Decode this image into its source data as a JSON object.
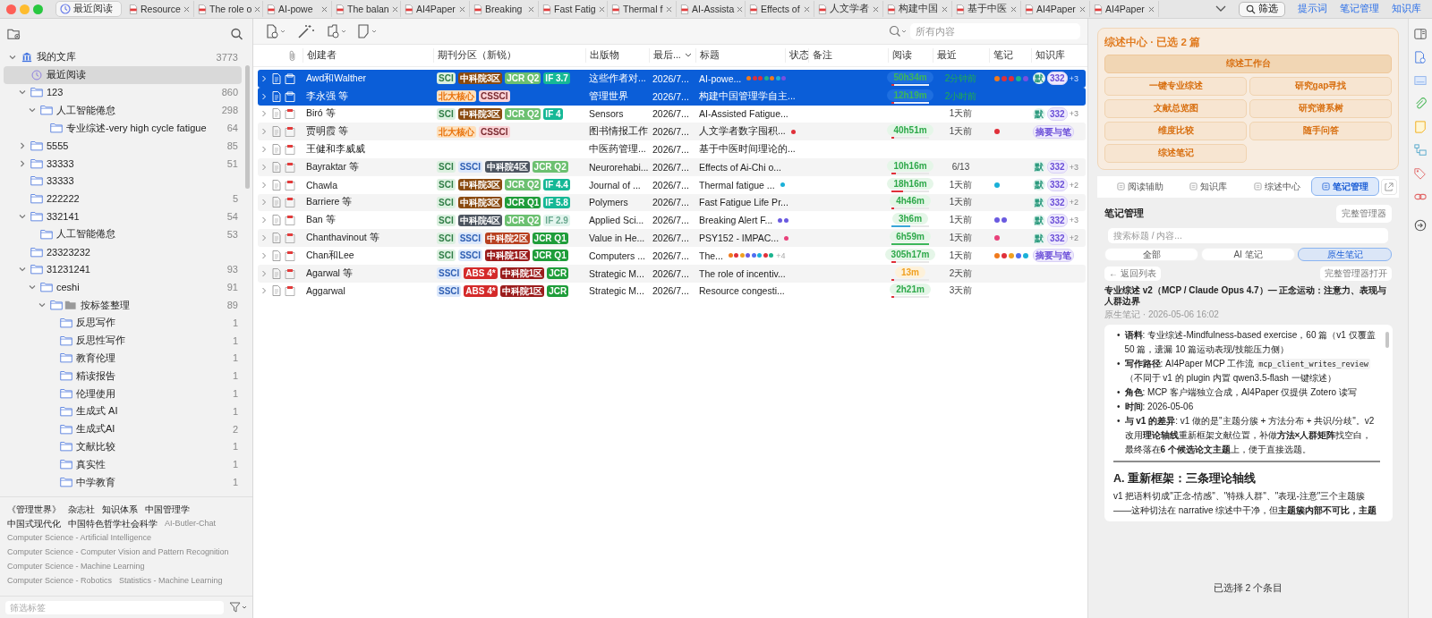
{
  "tabbar": {
    "tabs": [
      {
        "label": "最近阅读",
        "kind": "home",
        "selected": true
      },
      {
        "label": "Resource",
        "kind": "pdf",
        "selected": false
      },
      {
        "label": "The role o",
        "kind": "pdf",
        "selected": false
      },
      {
        "label": "AI-powe",
        "kind": "pdf",
        "selected": false
      },
      {
        "label": "The balan",
        "kind": "pdf",
        "selected": false
      },
      {
        "label": "AI4Paper",
        "kind": "pdf",
        "selected": false
      },
      {
        "label": "Breaking",
        "kind": "pdf",
        "selected": false
      },
      {
        "label": "Fast Fatig",
        "kind": "pdf",
        "selected": false
      },
      {
        "label": "Thermal f",
        "kind": "pdf",
        "selected": false
      },
      {
        "label": "AI-Assista",
        "kind": "pdf",
        "selected": false
      },
      {
        "label": "Effects of",
        "kind": "pdf",
        "selected": false
      },
      {
        "label": "人文学者",
        "kind": "pdf",
        "selected": false
      },
      {
        "label": "构建中国",
        "kind": "pdf",
        "selected": false
      },
      {
        "label": "基于中医",
        "kind": "pdf",
        "selected": false
      },
      {
        "label": "AI4Paper",
        "kind": "pdf",
        "selected": false
      },
      {
        "label": "AI4Paper",
        "kind": "pdf",
        "selected": false
      }
    ],
    "filter_button": "筛选",
    "links": [
      "提示词",
      "笔记管理",
      "知识库"
    ]
  },
  "sidebar": {
    "tree": [
      {
        "label": "我的文库",
        "count": "3773",
        "kind": "library",
        "expanded": true,
        "selected": false,
        "children": [
          {
            "label": "最近阅读",
            "kind": "clock",
            "selected": true
          },
          {
            "label": "123",
            "count": "860",
            "kind": "folder",
            "expanded": true,
            "selected": false,
            "children": [
              {
                "label": "人工智能倦怠",
                "count": "298",
                "kind": "folder",
                "expanded": true,
                "selected": false,
                "children": [
                  {
                    "label": "专业综述-very high cycle fatigue",
                    "count": "64",
                    "kind": "folder",
                    "selected": false
                  }
                ]
              }
            ]
          },
          {
            "label": "5555",
            "count": "85",
            "kind": "folder",
            "expanded": false,
            "selected": false
          },
          {
            "label": "33333",
            "count": "51",
            "kind": "folder",
            "expanded": false,
            "selected": false
          },
          {
            "label": "33333",
            "kind": "folder",
            "selected": false
          },
          {
            "label": "222222",
            "count": "5",
            "kind": "folder",
            "selected": false
          },
          {
            "label": "332141",
            "count": "54",
            "kind": "folder",
            "expanded": true,
            "selected": false,
            "children": [
              {
                "label": "人工智能倦怠",
                "count": "53",
                "kind": "folder",
                "selected": false
              }
            ]
          },
          {
            "label": "23323232",
            "kind": "folder",
            "selected": false
          },
          {
            "label": "31231241",
            "count": "93",
            "kind": "folder",
            "expanded": true,
            "selected": false,
            "children": [
              {
                "label": "ceshi",
                "count": "91",
                "kind": "folder",
                "expanded": true,
                "selected": false,
                "children": [
                  {
                    "label": "按标签整理",
                    "count": "89",
                    "kind": "tagfolder",
                    "expanded": true,
                    "selected": false,
                    "children": [
                      {
                        "label": "反思写作",
                        "count": "1",
                        "kind": "folder",
                        "selected": false
                      },
                      {
                        "label": "反思性写作",
                        "count": "1",
                        "kind": "folder",
                        "selected": false
                      },
                      {
                        "label": "教育伦理",
                        "count": "1",
                        "kind": "folder",
                        "selected": false
                      },
                      {
                        "label": "精读报告",
                        "count": "1",
                        "kind": "folder",
                        "selected": false
                      },
                      {
                        "label": "伦理使用",
                        "count": "1",
                        "kind": "folder",
                        "selected": false
                      },
                      {
                        "label": "生成式 AI",
                        "count": "1",
                        "kind": "folder",
                        "selected": false
                      },
                      {
                        "label": "生成式AI",
                        "count": "2",
                        "kind": "folder",
                        "selected": false
                      },
                      {
                        "label": "文献比较",
                        "count": "1",
                        "kind": "folder",
                        "selected": false
                      },
                      {
                        "label": "真实性",
                        "count": "1",
                        "kind": "folder",
                        "selected": false
                      },
                      {
                        "label": "中学教育",
                        "count": "1",
                        "kind": "folder",
                        "selected": false
                      }
                    ]
                  }
                ]
              }
            ]
          }
        ]
      }
    ],
    "tags": [
      {
        "label": "《管理世界》",
        "dim": false
      },
      {
        "label": "杂志社",
        "dim": false
      },
      {
        "label": "知识体系",
        "dim": false
      },
      {
        "label": "中国管理学",
        "dim": false
      },
      {
        "label": "中国式现代化",
        "dim": false
      },
      {
        "label": "中国特色哲学社会科学",
        "dim": false
      },
      {
        "label": "AI-Butler-Chat",
        "dim": true
      },
      {
        "label": "Computer Science - Artificial Intelligence",
        "dim": true
      },
      {
        "label": "Computer Science - Computer Vision and Pattern Recognition",
        "dim": true
      },
      {
        "label": "Computer Science - Machine Learning",
        "dim": true
      },
      {
        "label": "Computer Science - Robotics",
        "dim": true
      },
      {
        "label": "Statistics - Machine Learning",
        "dim": true
      }
    ],
    "filter": {
      "placeholder": "筛选标签"
    }
  },
  "toolbar": {
    "search": {
      "placeholder": "所有内容"
    }
  },
  "table": {
    "columns": [
      "创建者",
      "期刊分区（新锐）",
      "出版物",
      "最后...",
      "标题",
      "状态",
      "备注",
      "阅读",
      "最近",
      "笔记",
      "知识库"
    ],
    "rows": [
      {
        "selected": true,
        "creator": "Awd和Walther",
        "tags": [
          {
            "kind": "sci",
            "text": "SCI"
          },
          {
            "kind": "cas3",
            "text": "中科院3区"
          },
          {
            "kind": "jcrq2",
            "text": "JCR Q2"
          },
          {
            "kind": "if",
            "text": "IF 3.7"
          }
        ],
        "publication": "这些作者对...",
        "date": "2026/7...",
        "title": "AI-powe...",
        "title_dots": [
          {
            "color": "#f07a1c"
          },
          {
            "color": "#e0303a"
          },
          {
            "color": "#e0303a"
          },
          {
            "color": "#1bb48e"
          },
          {
            "color": "#f07a1c"
          },
          {
            "color": "#1ab0d8"
          },
          {
            "color": "#7b4fe0"
          }
        ],
        "reading": {
          "text": "50h34m",
          "kind": "normal",
          "level": 0.06,
          "color": "#e0303a"
        },
        "recent": "2分钟前",
        "notes": [
          {
            "color": "#f07a1c"
          },
          {
            "color": "#e0303a"
          },
          {
            "color": "#e0303a"
          },
          {
            "color": "#1bb48e"
          },
          {
            "color": "#7b4fe0"
          }
        ],
        "kb": [
          {
            "kind": "default",
            "text": "默"
          },
          {
            "kind": "count",
            "text": "332"
          }
        ],
        "kb_more": "+3"
      },
      {
        "selected": true,
        "creator": "李永强 等",
        "tags": [
          {
            "kind": "pku",
            "text": "北大核心"
          },
          {
            "kind": "cssci",
            "text": "CSSCI"
          }
        ],
        "publication": "管理世界",
        "date": "2026/7...",
        "title": "构建中国管理学自主...",
        "title_dots": [],
        "reading": {
          "text": "12h19m",
          "kind": "normal",
          "level": 0.06,
          "color": "#e0303a"
        },
        "recent": "2小时前",
        "notes": [],
        "kb": []
      },
      {
        "selected": false,
        "creator": "Biró 等",
        "tags": [
          {
            "kind": "sci",
            "text": "SCI"
          },
          {
            "kind": "cas3",
            "text": "中科院3区"
          },
          {
            "kind": "jcrq2",
            "text": "JCR Q2"
          },
          {
            "kind": "if",
            "text": "IF 4"
          }
        ],
        "publication": "Sensors",
        "date": "2026/7...",
        "title": "AI-Assisted Fatigue...",
        "title_dots": [],
        "recent": "1天前",
        "notes": [],
        "kb": [
          {
            "kind": "default",
            "text": "默"
          },
          {
            "kind": "count",
            "text": "332"
          }
        ],
        "kb_more": "+3"
      },
      {
        "selected": false,
        "creator": "贾明霞 等",
        "tags": [
          {
            "kind": "pku",
            "text": "北大核心"
          },
          {
            "kind": "cssci",
            "text": "CSSCI"
          }
        ],
        "publication": "图书情报工作",
        "date": "2026/7...",
        "title": "人文学者数字囤积...",
        "title_dots": [
          {
            "color": "#e0303a"
          }
        ],
        "reading": {
          "text": "40h51m",
          "kind": "normal",
          "level": 0.06,
          "color": "#e0303a"
        },
        "recent": "1天前",
        "notes": [
          {
            "color": "#e0303a"
          }
        ],
        "kb": [
          {
            "kind": "summary",
            "text": "摘要与笔"
          }
        ]
      },
      {
        "selected": false,
        "creator": "王健和李威威",
        "tags": [],
        "publication": "中医药管理...",
        "date": "2026/7...",
        "title": "基于中医时间理论的...",
        "title_dots": [],
        "notes": [],
        "kb": []
      },
      {
        "selected": false,
        "creator": "Bayraktar 等",
        "tags": [
          {
            "kind": "sci",
            "text": "SCI"
          },
          {
            "kind": "ssci",
            "text": "SSCI"
          },
          {
            "kind": "cas4",
            "text": "中科院4区"
          },
          {
            "kind": "jcrq2",
            "text": "JCR Q2"
          }
        ],
        "publication": "Neurorehabi...",
        "date": "2026/7...",
        "title": "Effects of Ai-Chi o...",
        "title_dots": [],
        "reading": {
          "text": "10h16m",
          "kind": "normal",
          "level": 0.12,
          "color": "#e0303a"
        },
        "recent": "6/13",
        "notes": [],
        "kb": [
          {
            "kind": "default",
            "text": "默"
          },
          {
            "kind": "count",
            "text": "332"
          }
        ],
        "kb_more": "+3"
      },
      {
        "selected": false,
        "creator": "Chawla",
        "tags": [
          {
            "kind": "sci",
            "text": "SCI"
          },
          {
            "kind": "cas3",
            "text": "中科院3区"
          },
          {
            "kind": "jcrq2",
            "text": "JCR Q2"
          },
          {
            "kind": "if",
            "text": "IF 4.4"
          }
        ],
        "publication": "Journal of ...",
        "date": "2026/7...",
        "title": "Thermal fatigue ...",
        "title_dots": [
          {
            "color": "#1ab0d8"
          }
        ],
        "reading": {
          "text": "18h16m",
          "kind": "normal",
          "level": 0.3,
          "color": "#e0303a"
        },
        "recent": "1天前",
        "notes": [
          {
            "color": "#1ab0d8"
          }
        ],
        "kb": [
          {
            "kind": "default",
            "text": "默"
          },
          {
            "kind": "count",
            "text": "332"
          }
        ],
        "kb_more": "+2"
      },
      {
        "selected": false,
        "creator": "Barriere 等",
        "tags": [
          {
            "kind": "sci",
            "text": "SCI"
          },
          {
            "kind": "cas3",
            "text": "中科院3区"
          },
          {
            "kind": "jcrq1",
            "text": "JCR Q1"
          },
          {
            "kind": "if",
            "text": "IF 5.8"
          }
        ],
        "publication": "Polymers",
        "date": "2026/7...",
        "title": "Fast Fatigue Life Pr...",
        "title_dots": [],
        "reading": {
          "text": "4h46m",
          "kind": "normal",
          "level": 0.06,
          "color": "#e0303a"
        },
        "recent": "1天前",
        "notes": [],
        "kb": [
          {
            "kind": "default",
            "text": "默"
          },
          {
            "kind": "count",
            "text": "332"
          }
        ],
        "kb_more": "+2"
      },
      {
        "selected": false,
        "creator": "Ban 等",
        "tags": [
          {
            "kind": "sci",
            "text": "SCI"
          },
          {
            "kind": "cas4",
            "text": "中科院4区"
          },
          {
            "kind": "jcrq2",
            "text": "JCR Q2"
          },
          {
            "kind": "iflow",
            "text": "IF 2.9"
          }
        ],
        "publication": "Applied Sci...",
        "date": "2026/7...",
        "title": "Breaking Alert F...",
        "title_dots": [
          {
            "color": "#6a5ae0"
          },
          {
            "color": "#6a5ae0"
          }
        ],
        "reading": {
          "text": "3h6m",
          "kind": "normal",
          "level": 0.5,
          "color": "#3aa6d8"
        },
        "recent": "1天前",
        "notes": [
          {
            "color": "#6a5ae0"
          },
          {
            "color": "#6a5ae0"
          }
        ],
        "kb": [
          {
            "kind": "default",
            "text": "默"
          },
          {
            "kind": "count",
            "text": "332"
          }
        ],
        "kb_more": "+3"
      },
      {
        "selected": false,
        "creator": "Chanthavinout 等",
        "tags": [
          {
            "kind": "sci",
            "text": "SCI"
          },
          {
            "kind": "ssci",
            "text": "SSCI"
          },
          {
            "kind": "cas2",
            "text": "中科院2区"
          },
          {
            "kind": "jcrq1",
            "text": "JCR Q1"
          }
        ],
        "publication": "Value in He...",
        "date": "2026/7...",
        "title": "PSY152 - IMPAC...",
        "title_dots": [
          {
            "color": "#e8407a"
          }
        ],
        "reading": {
          "text": "6h59m",
          "kind": "normal",
          "level": 1,
          "color": "#3cb75a"
        },
        "recent": "1天前",
        "notes": [
          {
            "color": "#e8407a"
          }
        ],
        "kb": [
          {
            "kind": "default",
            "text": "默"
          },
          {
            "kind": "count",
            "text": "332"
          }
        ],
        "kb_more": "+2"
      },
      {
        "selected": false,
        "creator": "Chan和Lee",
        "tags": [
          {
            "kind": "sci",
            "text": "SCI"
          },
          {
            "kind": "ssci",
            "text": "SSCI"
          },
          {
            "kind": "cas1",
            "text": "中科院1区"
          },
          {
            "kind": "jcrq1",
            "text": "JCR Q1"
          }
        ],
        "publication": "Computers ...",
        "date": "2026/7...",
        "title": "The...",
        "title_dots": [
          {
            "color": "#f07a1c"
          },
          {
            "color": "#e0303a"
          },
          {
            "color": "#f0a020"
          },
          {
            "color": "#6a5ae0"
          },
          {
            "color": "#4f6df0"
          },
          {
            "color": "#1ab0d8"
          },
          {
            "color": "#e0303a"
          },
          {
            "color": "#1bb48e"
          }
        ],
        "title_more": "+4",
        "reading": {
          "text": "305h17m",
          "kind": "normal",
          "level": 0.12,
          "color": "#e0303a"
        },
        "recent": "1天前",
        "notes": [
          {
            "color": "#f07a1c"
          },
          {
            "color": "#e0303a"
          },
          {
            "color": "#f0a020"
          },
          {
            "color": "#4f6df0"
          },
          {
            "color": "#1ab0d8"
          }
        ],
        "kb": [
          {
            "kind": "summary",
            "text": "摘要与笔"
          }
        ]
      },
      {
        "selected": false,
        "creator": "Agarwal 等",
        "tags": [
          {
            "kind": "ssci",
            "text": "SSCI"
          },
          {
            "kind": "abs",
            "text": "ABS 4*"
          },
          {
            "kind": "cas1",
            "text": "中科院1区"
          },
          {
            "kind": "jcrq1",
            "text": "JCR"
          }
        ],
        "publication": "Strategic M...",
        "date": "2026/7...",
        "title": "The role of incentiv...",
        "title_dots": [],
        "reading": {
          "text": "13m",
          "kind": "short",
          "level": 0.06,
          "color": "#e0303a"
        },
        "recent": "2天前",
        "notes": [],
        "kb": []
      },
      {
        "selected": false,
        "creator": "Aggarwal",
        "tags": [
          {
            "kind": "ssci",
            "text": "SSCI"
          },
          {
            "kind": "abs",
            "text": "ABS 4*"
          },
          {
            "kind": "cas1",
            "text": "中科院1区"
          },
          {
            "kind": "jcrq1",
            "text": "JCR"
          }
        ],
        "publication": "Strategic M...",
        "date": "2026/7...",
        "title": "Resource congesti...",
        "title_dots": [],
        "reading": {
          "text": "2h21m",
          "kind": "normal",
          "level": 0.06,
          "color": "#e0303a"
        },
        "recent": "3天前",
        "notes": [],
        "kb": []
      }
    ]
  },
  "panel": {
    "card": {
      "title": "综述中心 · 已选 2 篇",
      "main_button": "综述工作台",
      "buttons": [
        "一键专业综述",
        "研究gap寻找",
        "文献总览图",
        "研究谱系树",
        "维度比较",
        "随手问答",
        "综述笔记"
      ]
    },
    "tabs": [
      {
        "label": "阅读辅助",
        "selected": false
      },
      {
        "label": "知识库",
        "selected": false
      },
      {
        "label": "综述中心",
        "selected": false
      },
      {
        "label": "笔记管理",
        "selected": true
      }
    ],
    "section_title": "笔记管理",
    "manager_button": "完整管理器",
    "search": {
      "placeholder": "搜索标题 / 内容..."
    },
    "filters": [
      {
        "label": "全部",
        "selected": false
      },
      {
        "label": "AI 笔记",
        "selected": false
      },
      {
        "label": "原生笔记",
        "selected": true
      }
    ],
    "back_button": "← 返回列表",
    "open_button": "完整管理器打开",
    "note": {
      "title": "专业综述 v2（MCP / Claude Opus 4.7）— 正念运动：注意力、表现与人群边界",
      "meta": "原生笔记 · 2026-05-06 16:02",
      "bullets": [
        {
          "marker": "•",
          "parts": [
            {
              "kind": "rich",
              "text": "**语料**: 专业综述-Mindfulness-based exercise，60 篇（v1 仅覆盖 50 篇，遗漏 10 篇运动表现/技能压力侧）"
            }
          ]
        },
        {
          "marker": "•",
          "parts": [
            {
              "kind": "rich",
              "text": "**写作路径**: AI4Paper MCP 工作流 "
            },
            {
              "kind": "code",
              "text": "mcp_client_writes_review"
            },
            {
              "kind": "rich",
              "text": "（不同于 v1 的 plugin 内置 qwen3.5-flash 一键综述）"
            }
          ]
        },
        {
          "marker": "•",
          "parts": [
            {
              "kind": "rich",
              "text": "**角色**: MCP 客户端独立合成，AI4Paper 仅提供 Zotero 读写"
            }
          ]
        },
        {
          "marker": "•",
          "parts": [
            {
              "kind": "rich",
              "text": "**时间**: 2026-05-06"
            }
          ]
        },
        {
          "marker": "•",
          "parts": [
            {
              "kind": "rich",
              "text": "**与 v1 的差异**: v1 做的是\"主题分簇 + 方法分布 + 共识/分歧\"。v2 改用**理论轴线**重新框架文献位置，补做**方法×人群矩阵**找空白，最终落在**6 个候选论文主题**上，便于直接选题。"
            }
          ]
        }
      ],
      "heading": "A. 重新框架：三条理论轴线",
      "paragraph": "v1 把语料切成\"正念-情感\"、\"特殊人群\"、\"表现-注意\"三个主题簇——这种切法在 narrative 综述中干净，但**主题簇内部不可比，主题**"
    },
    "footer": "已选择 2 个条目"
  }
}
